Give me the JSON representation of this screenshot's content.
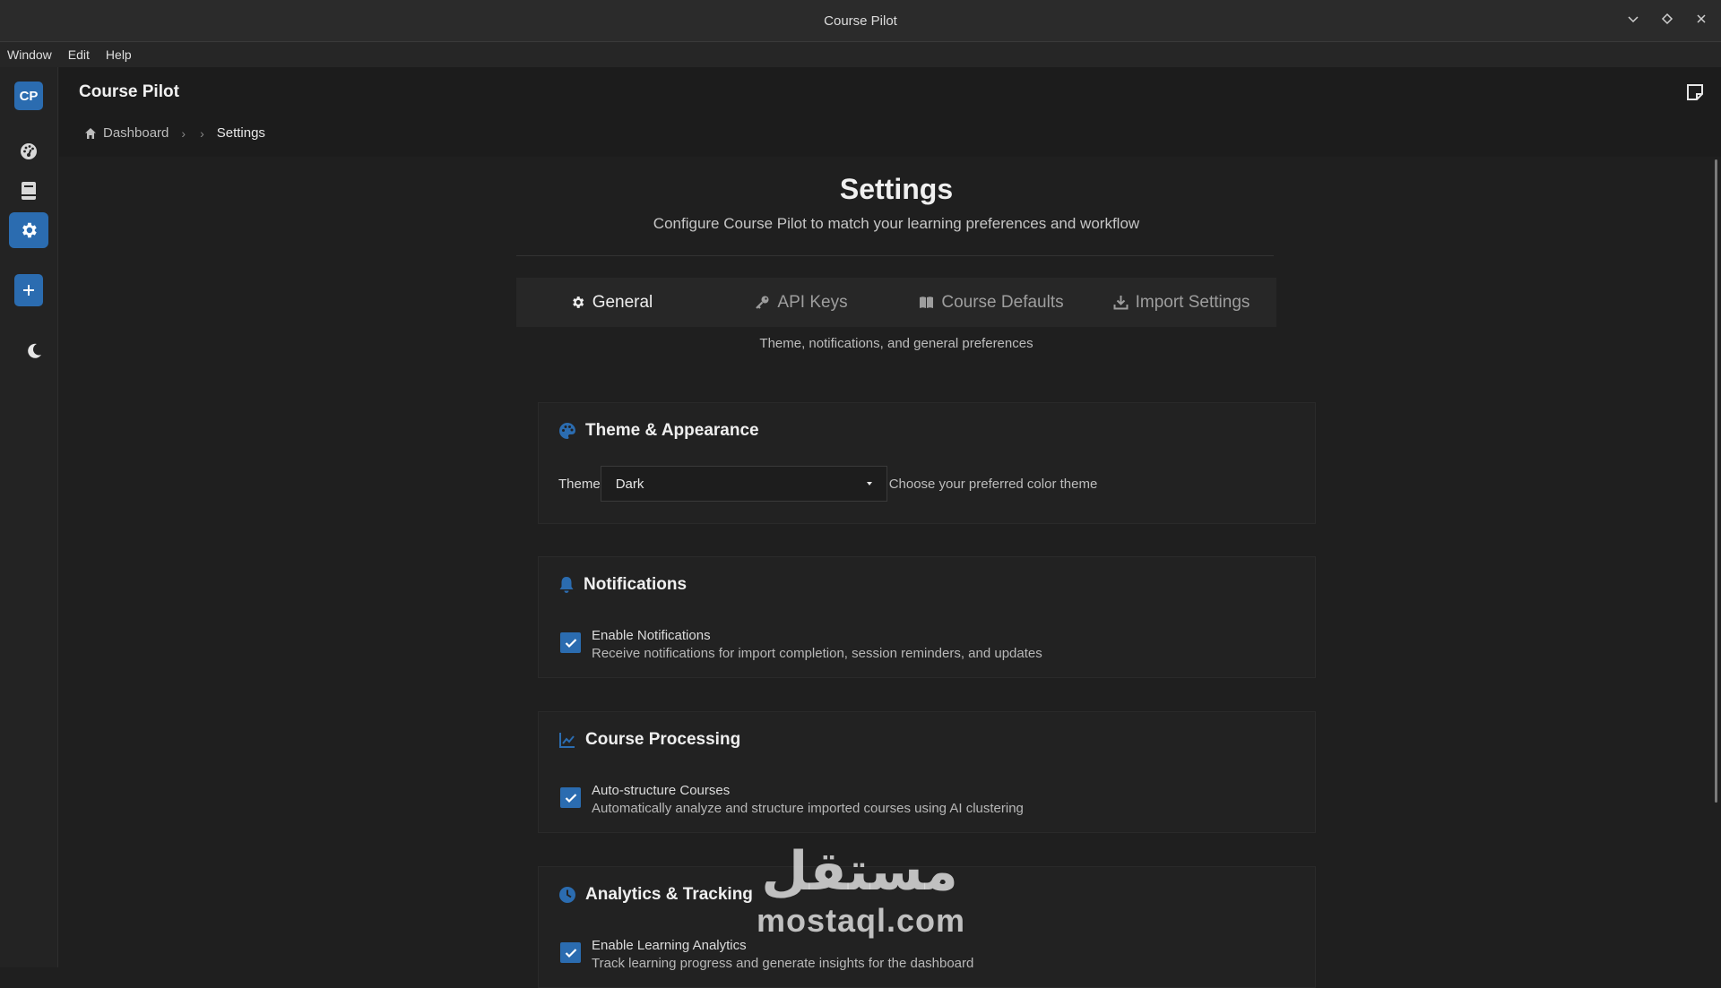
{
  "window": {
    "title": "Course Pilot",
    "controls": [
      "minimize",
      "maximize",
      "close"
    ]
  },
  "menubar": {
    "items": [
      "Window",
      "Edit",
      "Help"
    ]
  },
  "sidebar": {
    "logo": "CP",
    "items": [
      {
        "icon": "dashboard-icon"
      },
      {
        "icon": "book-icon"
      },
      {
        "icon": "gear-icon",
        "active": true
      },
      {
        "icon": "plus-icon"
      },
      {
        "icon": "moon-icon"
      }
    ]
  },
  "header": {
    "title": "Course Pilot",
    "breadcrumb": [
      "Dashboard",
      "Settings"
    ]
  },
  "page": {
    "title": "Settings",
    "subtitle": "Configure Course Pilot to match your learning preferences and workflow"
  },
  "tabs": {
    "items": [
      {
        "label": "General",
        "icon": "gear-icon",
        "active": true
      },
      {
        "label": "API Keys",
        "icon": "key-icon"
      },
      {
        "label": "Course Defaults",
        "icon": "book-open-icon"
      },
      {
        "label": "Import Settings",
        "icon": "download-icon"
      }
    ],
    "description": "Theme, notifications, and general preferences"
  },
  "sections": {
    "theme": {
      "title": "Theme & Appearance",
      "label": "Theme",
      "value": "Dark",
      "hint": "Choose your preferred color theme"
    },
    "notifications": {
      "title": "Notifications",
      "option_label": "Enable Notifications",
      "option_desc": "Receive notifications for import completion, session reminders, and updates",
      "checked": true
    },
    "processing": {
      "title": "Course Processing",
      "option_label": "Auto-structure Courses",
      "option_desc": "Automatically analyze and structure imported courses using AI clustering",
      "checked": true
    },
    "analytics": {
      "title": "Analytics & Tracking",
      "option_label": "Enable Learning Analytics",
      "option_desc": "Track learning progress and generate insights for the dashboard",
      "checked": true
    }
  },
  "watermark": {
    "arabic": "مستقل",
    "latin": "mostaql.com"
  },
  "colors": {
    "accent": "#2b6cb0",
    "background": "#1f1f1f",
    "card": "#222222"
  }
}
